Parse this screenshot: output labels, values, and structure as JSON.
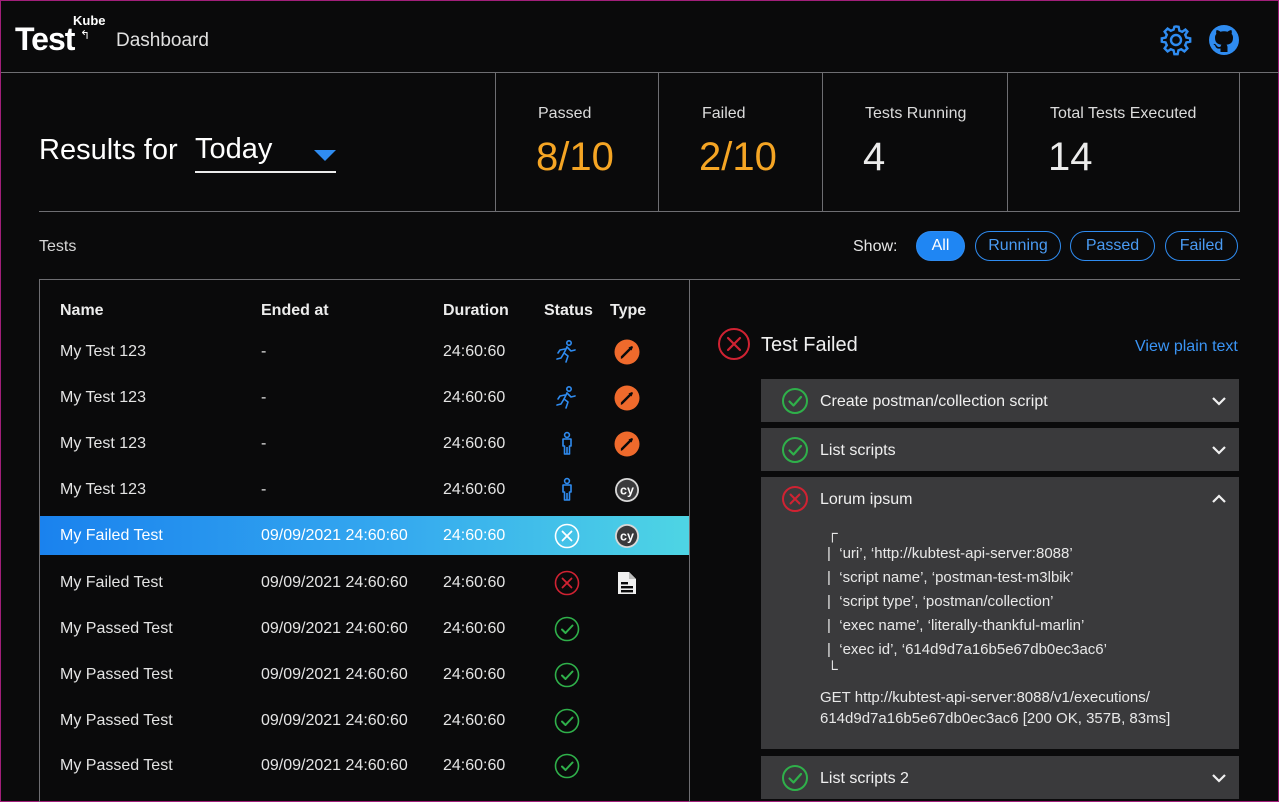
{
  "header": {
    "logo_text": "Test",
    "logo_sup": "Kube",
    "title": "Dashboard",
    "settings_icon": "gear-icon",
    "github_icon": "github-icon",
    "accent": "#2f8cf1"
  },
  "summary": {
    "results_label": "Results for",
    "period": "Today",
    "stats": [
      {
        "label": "Passed",
        "value": "8/10",
        "color": "#f5a524"
      },
      {
        "label": "Failed",
        "value": "2/10",
        "color": "#f5a524"
      },
      {
        "label": "Tests Running",
        "value": "4",
        "color": "#ececec"
      },
      {
        "label": "Total Tests Executed",
        "value": "14",
        "color": "#ececec"
      }
    ]
  },
  "filters": {
    "tests_label": "Tests",
    "show_label": "Show:",
    "options": [
      "All",
      "Running",
      "Passed",
      "Failed"
    ],
    "active": "All"
  },
  "table": {
    "columns": [
      "Name",
      "Ended at",
      "Duration",
      "Status",
      "Type"
    ],
    "rows": [
      {
        "name": "My Test 123",
        "ended": "-",
        "duration": "24:60:60",
        "status": "running",
        "type": "postman"
      },
      {
        "name": "My Test 123",
        "ended": "-",
        "duration": "24:60:60",
        "status": "running",
        "type": "postman"
      },
      {
        "name": "My Test 123",
        "ended": "-",
        "duration": "24:60:60",
        "status": "queued",
        "type": "postman"
      },
      {
        "name": "My Test 123",
        "ended": "-",
        "duration": "24:60:60",
        "status": "queued",
        "type": "cypress"
      },
      {
        "name": "My Failed Test",
        "ended": "09/09/2021 24:60:60",
        "duration": "24:60:60",
        "status": "failed",
        "type": "cypress",
        "selected": true
      },
      {
        "name": "My Failed Test",
        "ended": "09/09/2021 24:60:60",
        "duration": "24:60:60",
        "status": "failed",
        "type": "script"
      },
      {
        "name": "My Passed Test",
        "ended": "09/09/2021 24:60:60",
        "duration": "24:60:60",
        "status": "passed",
        "type": ""
      },
      {
        "name": "My Passed Test",
        "ended": "09/09/2021 24:60:60",
        "duration": "24:60:60",
        "status": "passed",
        "type": ""
      },
      {
        "name": "My Passed Test",
        "ended": "09/09/2021 24:60:60",
        "duration": "24:60:60",
        "status": "passed",
        "type": ""
      },
      {
        "name": "My Passed Test",
        "ended": "09/09/2021 24:60:60",
        "duration": "24:60:60",
        "status": "passed",
        "type": ""
      }
    ],
    "status_icons": {
      "running": "running-person-icon",
      "queued": "standing-person-icon",
      "failed": "x-circle-icon",
      "passed": "check-circle-icon"
    },
    "type_icons": {
      "postman": "postman-icon",
      "cypress": "cypress-icon",
      "script": "document-icon"
    },
    "type_cypress_text": "cy"
  },
  "detail": {
    "title": "Test Failed",
    "view_plain_text": "View plain text",
    "status_icon": "x-circle-icon",
    "steps": [
      {
        "title": "Create postman/collection script",
        "status": "passed",
        "expanded": false
      },
      {
        "title": "List scripts",
        "status": "passed",
        "expanded": false
      },
      {
        "title": "Lorum ipsum",
        "status": "failed",
        "expanded": true,
        "log_lines": [
          "‘uri’, ‘http://kubtest-api-server:8088’",
          "‘script name’, ‘postman-test-m3lbik’",
          "‘script type’, ‘postman/collection’",
          "‘exec name’, ‘literally-thankful-marlin’",
          "‘exec id’, ‘614d9d7a16b5e67db0ec3ac6’"
        ],
        "request_line_1": "GET http://kubtest-api-server:8088/v1/executions/",
        "request_line_2": "614d9d7a16b5e67db0ec3ac6 [200 OK, 357B, 83ms]"
      },
      {
        "title": "List scripts 2",
        "status": "passed",
        "expanded": false
      }
    ]
  },
  "colors": {
    "pass": "#2fb04a",
    "fail": "#d02232",
    "running": "#2f8cf1",
    "postman": "#ef6a2c"
  }
}
